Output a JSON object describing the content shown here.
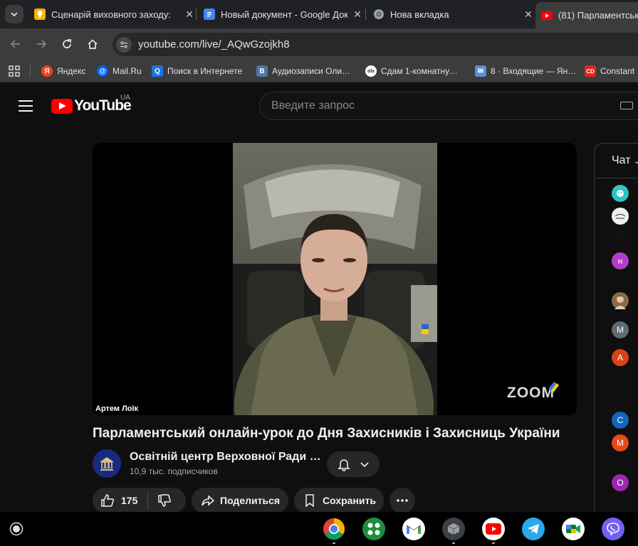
{
  "browser": {
    "tabs": [
      {
        "title": "Сценарій виховного заходу: ",
        "favicon": "lightbulb-icon",
        "color": "#f6b400"
      },
      {
        "title": "Новый документ - Google Док",
        "favicon": "google-docs-icon",
        "color": "#4285f4"
      },
      {
        "title": "Нова вкладка",
        "favicon": "chrome-icon",
        "color": "#9aa0a6"
      },
      {
        "title": "(81) Парламентськ",
        "favicon": "youtube-icon",
        "color": "#ff0000"
      }
    ],
    "url": "youtube.com/live/_AQwGzojkh8",
    "bookmarks": [
      {
        "label": "Яндекс",
        "icon": "yandex-icon",
        "color": "#fc3f1d",
        "glyph": "Я"
      },
      {
        "label": "Mail.Ru",
        "icon": "mailru-icon",
        "color": "#005ff9",
        "glyph": "@"
      },
      {
        "label": "Поиск в Интернете",
        "icon": "search-icon",
        "color": "#1a73e8",
        "glyph": "Q"
      },
      {
        "label": "Аудиозаписи Оли…",
        "icon": "vk-icon",
        "color": "#4a76a8",
        "glyph": "B"
      },
      {
        "label": "Сдам 1-комнатну…",
        "icon": "olx-icon",
        "color": "#ffffff",
        "glyph": "ok"
      },
      {
        "label": "8 · Входящие — Ян…",
        "icon": "mail-icon",
        "color": "#5b8dd9",
        "glyph": "✉"
      },
      {
        "label": "Constant",
        "icon": "cd-icon",
        "color": "#e1261c",
        "glyph": "CD"
      }
    ]
  },
  "youtube": {
    "logo_text": "YouTube",
    "country_code": "UA",
    "search_placeholder": "Введите запрос",
    "video": {
      "participant_name": "Артем Лоїк",
      "watermark": "ZOOM",
      "title": "Парламентський онлайн-урок до Дня Захисників і Захисниць України"
    },
    "channel": {
      "name": "Освітній центр Верховної Ради …",
      "subscribers": "10,9 тыс. подписчиков"
    },
    "actions": {
      "likes": "175",
      "share_label": "Поделиться",
      "save_label": "Сохранить"
    },
    "chat": {
      "title": "Чат",
      "avatars": [
        {
          "letter": "",
          "color": "#2ec4c4"
        },
        {
          "letter": "",
          "color": "#f0f0f0"
        },
        {
          "letter": "",
          "color": "#111111"
        },
        {
          "letter": "н",
          "color": "#b03fc6"
        },
        {
          "letter": "",
          "color": "#8a6a4a"
        },
        {
          "letter": "M",
          "color": "#5f6b73"
        },
        {
          "letter": "A",
          "color": "#d84315"
        },
        {
          "letter": "C",
          "color": "#1565c0"
        },
        {
          "letter": "M",
          "color": "#e64a19"
        },
        {
          "letter": "O",
          "color": "#9c27b0"
        }
      ]
    }
  },
  "shelf": {
    "apps": [
      {
        "name": "chrome-icon",
        "color": "#ffffff"
      },
      {
        "name": "app-grid-icon",
        "color": "#1e8e3e"
      },
      {
        "name": "gmail-icon",
        "color": "#ffffff"
      },
      {
        "name": "cube-app-icon",
        "color": "#5f6368"
      },
      {
        "name": "youtube-icon",
        "color": "#ffffff"
      },
      {
        "name": "telegram-icon",
        "color": "#29a9eb"
      },
      {
        "name": "google-meet-icon",
        "color": "#ffffff"
      },
      {
        "name": "viber-icon",
        "color": "#7360f2"
      }
    ]
  }
}
